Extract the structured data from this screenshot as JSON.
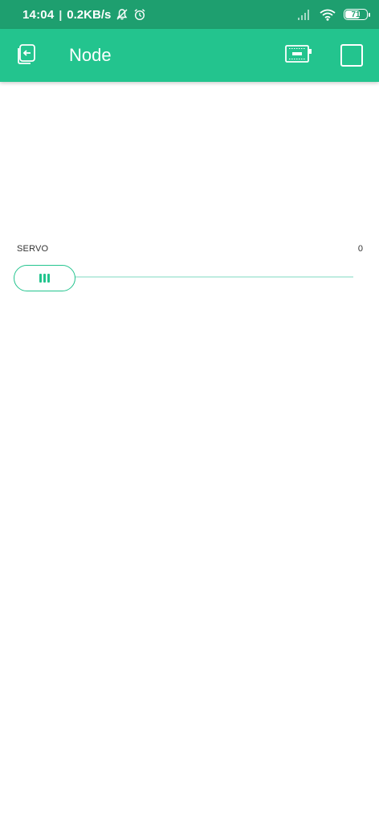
{
  "status_bar": {
    "time": "14:04",
    "separator": "|",
    "network_speed": "0.2KB/s",
    "icons": [
      "bell-off-icon",
      "alarm-icon",
      "signal-icon",
      "wifi-icon",
      "battery-icon"
    ],
    "battery_level": "71",
    "battery_fraction": 0.71
  },
  "app_bar": {
    "title": "Node",
    "back_icon": "back-icon",
    "device_icon": "device-icon",
    "stop_icon": "stop-icon",
    "color": "#23c48e"
  },
  "slider": {
    "label": "SERVO",
    "value": "0",
    "level": 0,
    "accent": "#23c48e"
  }
}
